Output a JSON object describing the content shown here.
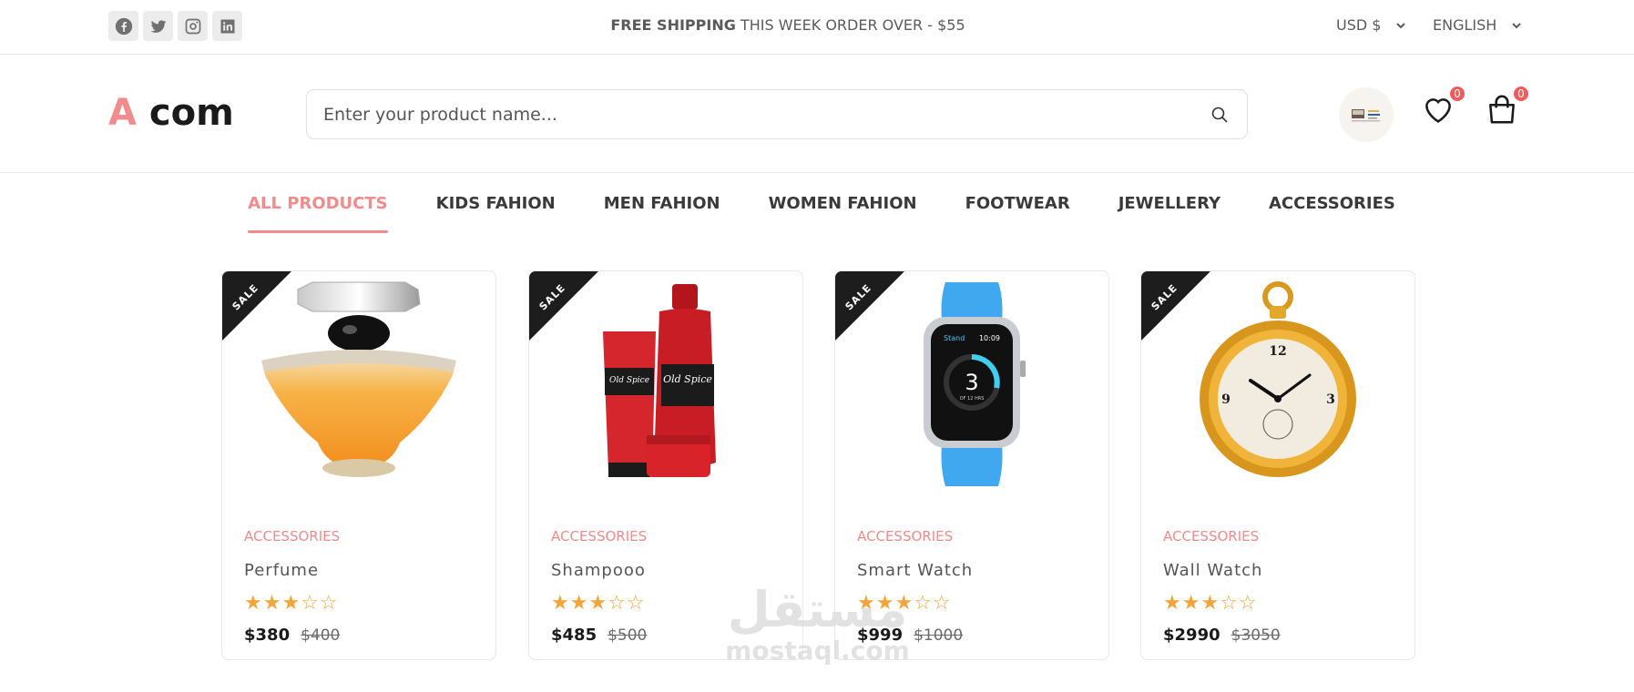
{
  "topbar": {
    "social": [
      "facebook-icon",
      "twitter-icon",
      "instagram-icon",
      "linkedin-icon"
    ],
    "shipping_bold": "FREE SHIPPING",
    "shipping_rest": " THIS WEEK ORDER OVER - $55",
    "currency": "USD $",
    "language": "ENGLISH"
  },
  "header": {
    "logo_a": "A",
    "logo_rest": " com",
    "search_placeholder": "Enter your product name...",
    "wishlist_count": "0",
    "cart_count": "0"
  },
  "nav": {
    "items": [
      {
        "label": "ALL PRODUCTS",
        "active": true
      },
      {
        "label": "KIDS FAHION",
        "active": false
      },
      {
        "label": "MEN FAHION",
        "active": false
      },
      {
        "label": "WOMEN FAHION",
        "active": false
      },
      {
        "label": "FOOTWEAR",
        "active": false
      },
      {
        "label": "JEWELLERY",
        "active": false
      },
      {
        "label": "ACCESSORIES",
        "active": false
      }
    ]
  },
  "products": [
    {
      "badge": "SALE",
      "category": "ACCESSORIES",
      "name": "Perfume",
      "rating": 3,
      "max_rating": 5,
      "price": "$380",
      "old_price": "$400",
      "image": "perfume-bottle"
    },
    {
      "badge": "SALE",
      "category": "ACCESSORIES",
      "name": "Shampooo",
      "rating": 3,
      "max_rating": 5,
      "price": "$485",
      "old_price": "$500",
      "image": "shampoo-bottles"
    },
    {
      "badge": "SALE",
      "category": "ACCESSORIES",
      "name": "Smart Watch",
      "rating": 3,
      "max_rating": 5,
      "price": "$999",
      "old_price": "$1000",
      "image": "smart-watch"
    },
    {
      "badge": "SALE",
      "category": "ACCESSORIES",
      "name": "Wall Watch",
      "rating": 3,
      "max_rating": 5,
      "price": "$2990",
      "old_price": "$3050",
      "image": "pocket-watch"
    }
  ],
  "watermark": {
    "arabic": "مستقل",
    "latin": "mostaql.com"
  },
  "colors": {
    "accent": "#f28b8b",
    "badge": "#f05b5b",
    "star": "#f2a53b",
    "ribbon": "#1d1d1d"
  }
}
